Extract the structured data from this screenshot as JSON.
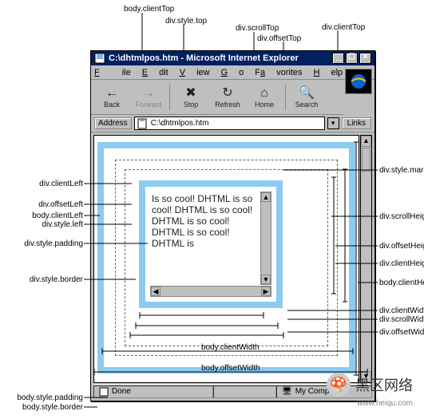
{
  "window": {
    "title": "C:\\dhtmlpos.htm - Microsoft Internet Explorer",
    "min_btn": "_",
    "max_btn": "☐",
    "close_btn": "×"
  },
  "menu": {
    "file": "File",
    "edit": "Edit",
    "view": "View",
    "go": "Go",
    "favorites": "Favorites",
    "help": "Help"
  },
  "toolbar": {
    "back": "Back",
    "back_icon": "←",
    "forward": "Forward",
    "forward_icon": "→",
    "stop": "Stop",
    "stop_icon": "✖",
    "refresh": "Refresh",
    "refresh_icon": "↻",
    "home": "Home",
    "home_icon": "⌂",
    "search": "Search",
    "search_icon": "🔍",
    "ie_logo": "e"
  },
  "address": {
    "label": "Address",
    "value": "C:\\dhtmlpos.htm",
    "links": "Links",
    "drop": "▾"
  },
  "status": {
    "done": "Done",
    "zone_icon": "🖥",
    "zone": "My Computer"
  },
  "div_text": "Is so cool! DHTML is so cool! DHTML is so cool! DHTML is so cool! DHTML is so cool! DHTML is",
  "labels": {
    "body_clientTop": "body.clientTop",
    "div_style_top": "div.style.top",
    "div_scrollTop": "div.scrollTop",
    "div_offsetTop": "div.offsetTop",
    "div_clientTop": "div.clientTop",
    "div_clientLeft": "div.clientLeft",
    "div_offsetLeft": "div.offsetLeft",
    "body_clientLeft": "body.clientLeft",
    "div_style_left": "div.style.left",
    "div_style_padding": "div.style.padding",
    "div_style_border": "div.style.border",
    "div_style_margin": "div.style.margin",
    "div_scrollHeight": "div.scrollHeight",
    "div_offsetHeight": "div.offsetHeight",
    "div_clientHeight": "div.clientHeight",
    "body_clientHeight": "body.clientHeight",
    "body_clientWidth": "body.clientWidth",
    "body_offsetWidth": "body.offsetWidth",
    "div_clientWidth": "div.clientWidth",
    "div_scrollWidth": "div.scrollWidth",
    "div_offsetWidth": "div.offsetWidth",
    "body_style_padding": "body.style.padding",
    "body_style_border": "body.style.border"
  },
  "watermark": {
    "text": "黑区网络",
    "url": "www.heiqu.com"
  }
}
